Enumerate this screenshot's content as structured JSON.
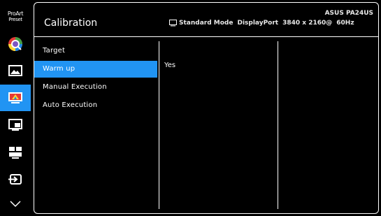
{
  "sidebar": {
    "logo_line1": "ProArt",
    "logo_line2": "Preset",
    "active_index": 3
  },
  "header": {
    "title": "Calibration",
    "mode": "Standard Mode",
    "input": "DisplayPort",
    "resolution": "3840 x 2160@",
    "refresh": "60Hz",
    "model": "ASUS PA24US"
  },
  "menu": {
    "items": [
      {
        "label": "Target"
      },
      {
        "label": "Warm up"
      },
      {
        "label": "Manual Execution"
      },
      {
        "label": "Auto Execution"
      }
    ],
    "selected_index": 1
  },
  "submenu": {
    "options": [
      {
        "label": "Yes"
      }
    ]
  },
  "colors": {
    "accent": "#2194f3",
    "background": "#000000",
    "text": "#ffffff"
  }
}
